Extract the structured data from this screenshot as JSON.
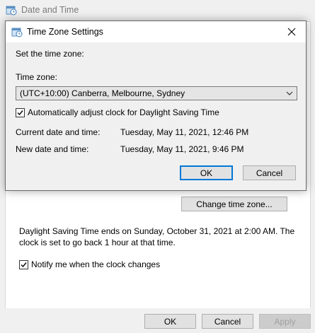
{
  "parent": {
    "title": "Date and Time",
    "change_time_zone_label": "Change time zone...",
    "dst_notice": "Daylight Saving Time ends on Sunday, October 31, 2021 at 2:00 AM. The clock is set to go back 1 hour at that time.",
    "notify_label": "Notify me when the clock changes",
    "notify_checked": true,
    "buttons": {
      "ok": "OK",
      "cancel": "Cancel",
      "apply": "Apply"
    }
  },
  "dialog": {
    "title": "Time Zone Settings",
    "set_time_zone_label": "Set the time zone:",
    "time_zone_label": "Time zone:",
    "time_zone_value": "(UTC+10:00) Canberra, Melbourne, Sydney",
    "dst_auto_label": "Automatically adjust clock for Daylight Saving Time",
    "dst_auto_checked": true,
    "current_label": "Current date and time:",
    "current_value": "Tuesday, May 11, 2021, 12:46 PM",
    "new_label": "New date and time:",
    "new_value": "Tuesday, May 11, 2021, 9:46 PM",
    "buttons": {
      "ok": "OK",
      "cancel": "Cancel"
    }
  },
  "icons": {
    "window": "clock-calendar-icon",
    "close": "close-icon",
    "dropdown": "chevron-down-icon",
    "check": "checkmark-icon"
  },
  "colors": {
    "accent": "#0078d7",
    "button_face": "#e1e1e1",
    "window_bg": "#f0f0f0"
  }
}
